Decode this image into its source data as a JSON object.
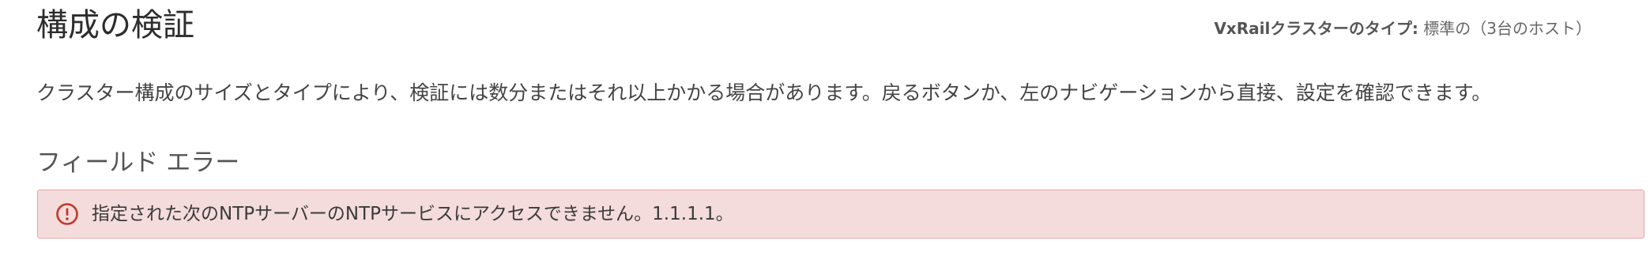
{
  "header": {
    "title": "構成の検証",
    "cluster_type_label": "VxRailクラスターのタイプ:",
    "cluster_type_value": "標準の（3台のホスト）"
  },
  "main": {
    "description": "クラスター構成のサイズとタイプにより、検証には数分またはそれ以上かかる場合があります。戻るボタンか、左のナビゲーションから直接、設定を確認できます。",
    "section_title": "フィールド エラー",
    "error": {
      "icon": "alert-circle-icon",
      "message": "指定された次のNTPサーバーのNTPサービスにアクセスできません。1.1.1.1。"
    }
  },
  "colors": {
    "error_background": "#f4dcdc",
    "error_border": "#e7a5a5",
    "error_icon": "#c0392b"
  }
}
